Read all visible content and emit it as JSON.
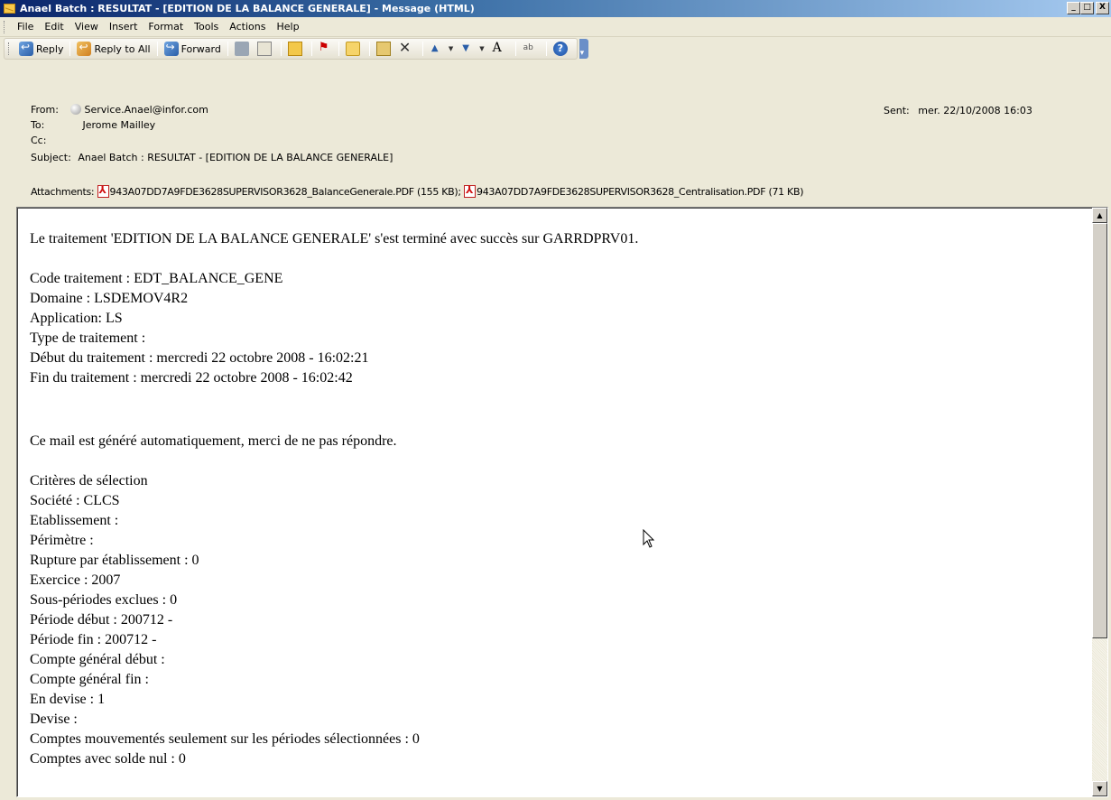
{
  "window": {
    "title": "Anael Batch : RESULTAT - [EDITION DE LA BALANCE GENERALE] - Message (HTML)",
    "min": "_",
    "max": "□",
    "close": "X"
  },
  "menu": [
    "File",
    "Edit",
    "View",
    "Insert",
    "Format",
    "Tools",
    "Actions",
    "Help"
  ],
  "toolbar": {
    "reply": "Reply",
    "reply_all": "Reply to All",
    "forward": "Forward"
  },
  "header": {
    "from_label": "From:",
    "from_value": "Service.Anael@infor.com",
    "to_label": "To:",
    "to_value": "Jerome Mailley",
    "cc_label": "Cc:",
    "cc_value": "",
    "subject_label": "Subject:",
    "subject_value": "Anael Batch : RESULTAT - [EDITION DE LA BALANCE GENERALE]",
    "sent_label": "Sent:",
    "sent_value": "mer. 22/10/2008 16:03",
    "attachments_label": "Attachments:",
    "attachments": [
      {
        "name": "943A07DD7A9FDE3628SUPERVISOR3628_BalanceGenerale.PDF",
        "size": "(155 KB)",
        "sep": ";"
      },
      {
        "name": "943A07DD7A9FDE3628SUPERVISOR3628_Centralisation.PDF",
        "size": "(71 KB)",
        "sep": ""
      }
    ]
  },
  "message": {
    "intro": "Le traitement 'EDITION DE LA BALANCE GENERALE' s'est terminé avec succès sur GARRDPRV01.",
    "details": [
      "Code traitement : EDT_BALANCE_GENE",
      "Domaine : LSDEMOV4R2",
      "Application: LS",
      "Type de traitement :",
      "Début du traitement : mercredi 22 octobre 2008 - 16:02:21",
      "Fin du traitement : mercredi 22 octobre 2008 - 16:02:42"
    ],
    "auto_notice": "Ce mail est généré automatiquement, merci de ne pas répondre.",
    "criteria": [
      "Critères de sélection",
      "Société : CLCS",
      "Etablissement :",
      "Périmètre :",
      "Rupture par établissement : 0",
      "Exercice : 2007",
      "Sous-périodes exclues : 0",
      "Période début : 200712 -",
      "Période fin : 200712 -",
      "Compte général début :",
      "Compte général fin :",
      "En devise : 1",
      "Devise :",
      "Comptes mouvementés seulement sur les périodes sélectionnées : 0",
      "Comptes avec solde nul : 0"
    ]
  }
}
